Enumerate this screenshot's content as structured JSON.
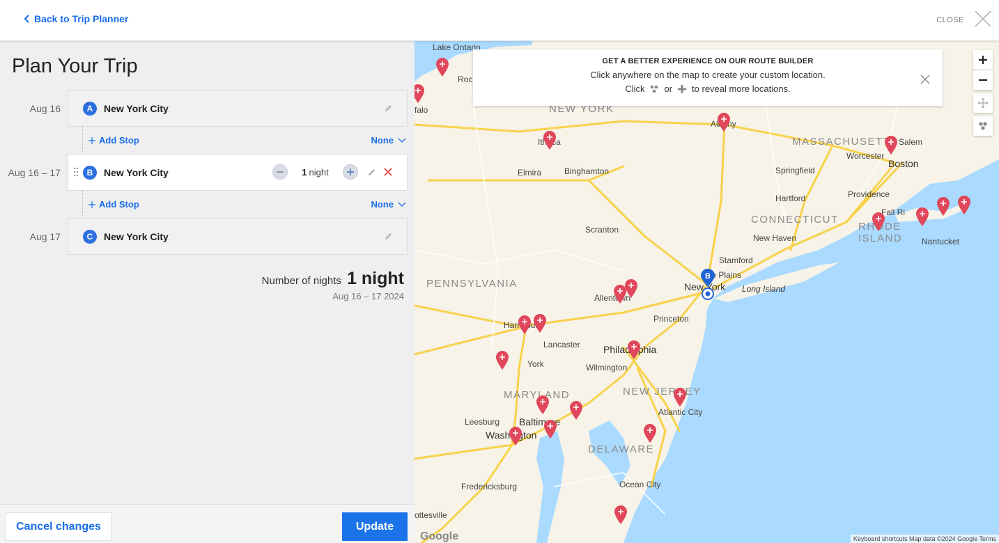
{
  "header": {
    "back_label": "Back to Trip Planner",
    "close_label": "CLOSE"
  },
  "planner": {
    "title": "Plan Your Trip",
    "stops": [
      {
        "letter": "A",
        "date": "Aug 16",
        "name": "New York City"
      },
      {
        "letter": "B",
        "date": "Aug 16 – 17",
        "name": "New York City",
        "nights_value": "1",
        "nights_unit": "night"
      },
      {
        "letter": "C",
        "date": "Aug 17",
        "name": "New York City"
      }
    ],
    "add_stop_label": "Add Stop",
    "none_label": "None",
    "summary_label": "Number of nights",
    "summary_value": "1 night",
    "summary_dates": "Aug 16 – 17 2024"
  },
  "footer": {
    "cancel_label": "Cancel changes",
    "update_label": "Update"
  },
  "banner": {
    "title": "GET A BETTER EXPERIENCE ON OUR ROUTE BUILDER",
    "line1": "Click anywhere on the map to create your custom location.",
    "line2_a": "Click",
    "line2_b": "or",
    "line2_c": "to reveal more locations."
  },
  "map": {
    "states": [
      "NEW YORK",
      "MASSACHUSETTS",
      "CONNECTICUT",
      "RHODE",
      "ISLAND",
      "PENNSYLVANIA",
      "MARYLAND",
      "NEW JERSEY",
      "DELAWARE"
    ],
    "cities": {
      "lake": "Lake Ontario",
      "roch": "Roc",
      "falo": "falo",
      "ithaca": "Ithaca",
      "albany": "Albany",
      "elmira": "Elmira",
      "binghamton": "Binghamton",
      "springfield": "Springfield",
      "worcester": "Worcester",
      "boston": "Boston",
      "salem": "Salem",
      "providence": "Providence",
      "hartford": "Hartford",
      "fallriver": "Fall Ri",
      "scranton": "Scranton",
      "newhaven": "New Haven",
      "nantucket": "Nantucket",
      "stamford": "Stamford",
      "whiteplains": "te Plains",
      "newyork": "New York",
      "longisland": "Long Island",
      "allentown": "Allentown",
      "harrisburg": "Harrisburg",
      "princeton": "Princeton",
      "lancaster": "Lancaster",
      "philadelphia": "Philadelphia",
      "york": "York",
      "wilmington": "Wilmington",
      "atlanticcity": "Atlantic City",
      "baltimore": "Baltimore",
      "leesburg": "Leesburg",
      "washington": "Washington",
      "fredericksburg": "Fredericksburg",
      "oceancity": "Ocean City",
      "ottesville": "ottesville"
    },
    "marker_letter": "B",
    "google": "Google",
    "attribution": "Keyboard shortcuts   Map data ©2024 Google   Terms"
  },
  "colors": {
    "accent": "#1a73e8",
    "poi": "#e0475b",
    "water": "#aadaff",
    "land": "#f7f3e8",
    "highway": "#f8d24a"
  }
}
